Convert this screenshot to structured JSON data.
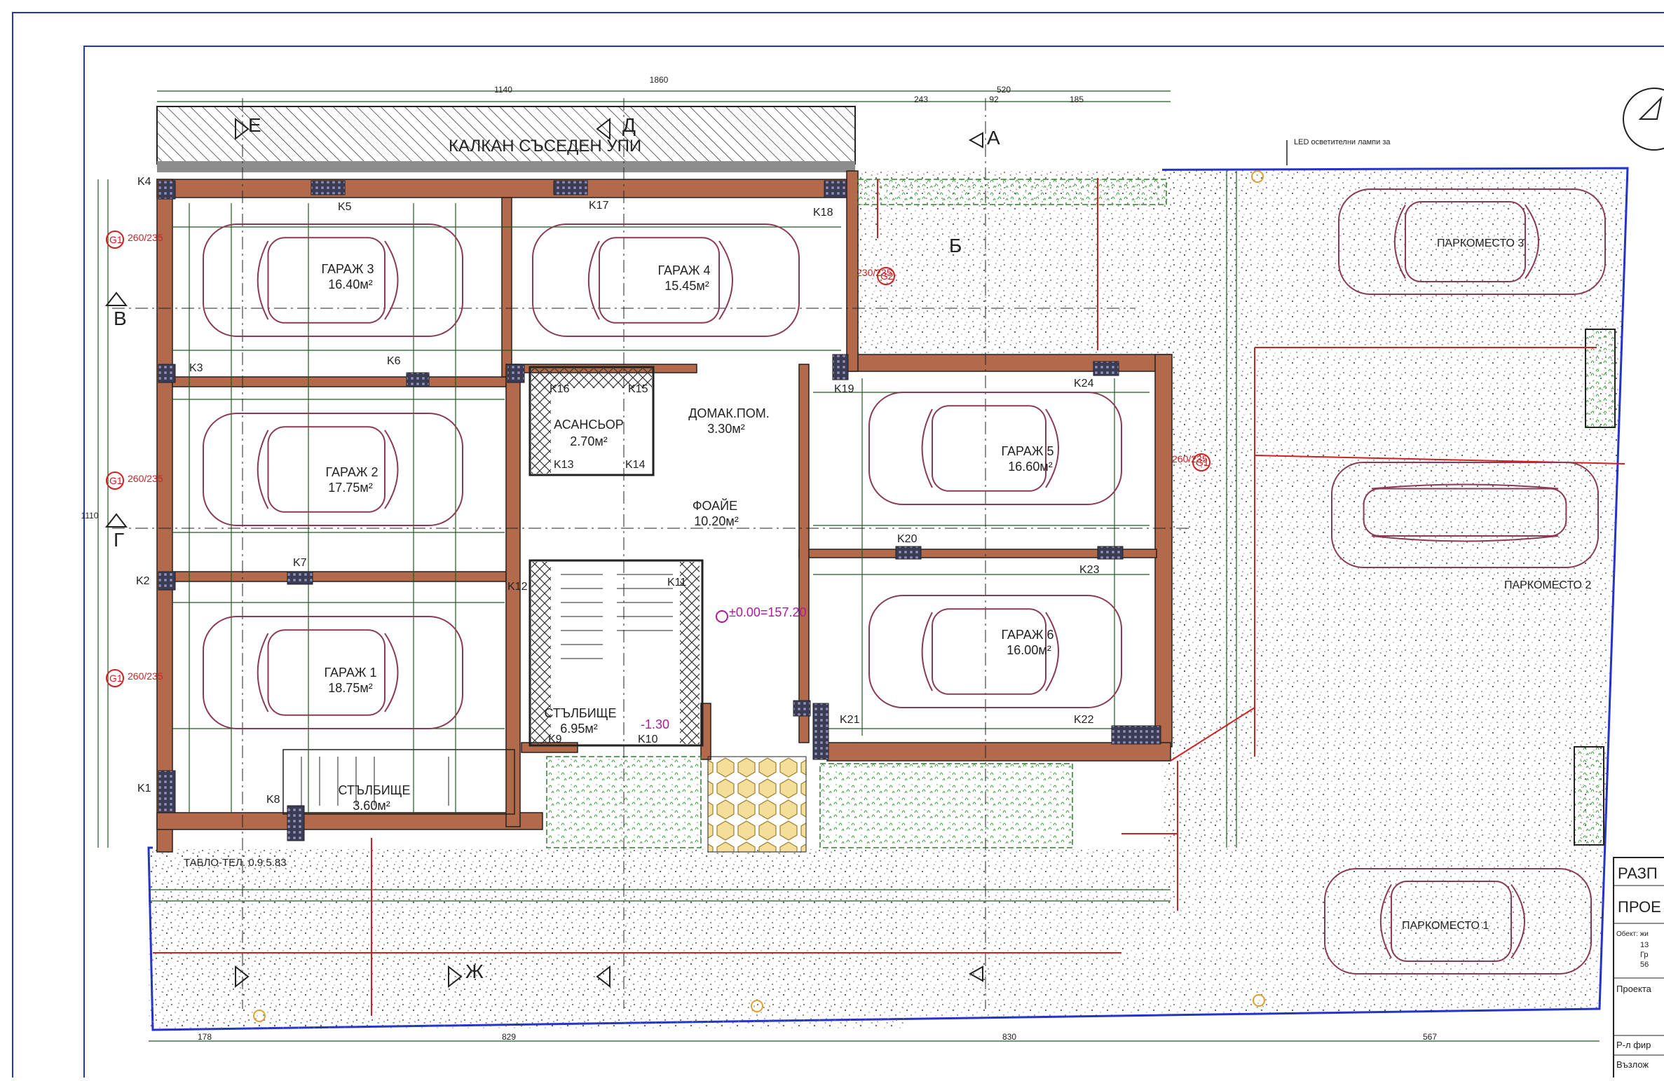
{
  "drawing": {
    "neighbor_wall_label": "КАЛКАН СЪСЕДЕН УПИ",
    "sections": [
      "В",
      "Г",
      "Д",
      "Е",
      "Ж",
      "А",
      "Б"
    ],
    "garages": [
      {
        "name": "ГАРАЖ 3",
        "area": "16.40м²"
      },
      {
        "name": "ГАРАЖ 4",
        "area": "15.45м²"
      },
      {
        "name": "ГАРАЖ 2",
        "area": "17.75м²"
      },
      {
        "name": "ГАРАЖ 1",
        "area": "18.75м²"
      },
      {
        "name": "ГАРАЖ 5",
        "area": "16.60м²"
      },
      {
        "name": "ГАРАЖ 6",
        "area": "16.00м²"
      }
    ],
    "rooms": [
      {
        "name": "АСАНСЬОР",
        "area": "2.70м²"
      },
      {
        "name": "ДОМАК.ПОМ.",
        "area": "3.30м²"
      },
      {
        "name": "ФОАЙЕ",
        "area": "10.20м²"
      },
      {
        "name": "СТЪЛБИЩЕ",
        "area": "6.95м²"
      },
      {
        "name": "СТЪЛБИЩЕ",
        "area": "3.60м²"
      }
    ],
    "parking": [
      "ПАРКОМЕСТО 3",
      "ПАРКОМЕСТО 2",
      "ПАРКОМЕСТО 1"
    ],
    "columns": [
      "K4",
      "K5",
      "K17",
      "K18",
      "K3",
      "K6",
      "K16",
      "K15",
      "K19",
      "K24",
      "K13",
      "K14",
      "K7",
      "K2",
      "K12",
      "K11",
      "K20",
      "K23",
      "K21",
      "K22",
      "K1",
      "K8",
      "K9",
      "K10"
    ],
    "level_mark": "±0.00=157.20",
    "level_minus": "-1.30",
    "led_note": "LED осветителни лампи за",
    "label_tablo": "ТАБЛО-ТЕЛ. 0.9 5.83",
    "door_marks": {
      "g1": "G1",
      "g1_dims": "260/235",
      "g2": "G2",
      "g2_dims": "230/235",
      "g3": "G1",
      "g3_dims": "260/235",
      "g4": "G1",
      "g4_dims": "260/235",
      "g5": "G1",
      "g5_dims": "260/235"
    },
    "dims_top": {
      "overall": "1860",
      "left": "1140",
      "right": "520",
      "a": "243",
      "b": "92",
      "c": "185"
    },
    "dims_bottom": {
      "a": "178",
      "b": "829",
      "c": "830",
      "d": "567"
    },
    "dims_side": {
      "left_total": "1110"
    }
  },
  "title_block": {
    "row1": "РАЗП",
    "row2": "ПРОЕ",
    "obekt_label": "Обект: жи",
    "obekt_lines": [
      "13",
      "Гр",
      "56"
    ],
    "proekt_label": "Проекта",
    "firm_label": "Р-л фир",
    "assign_label": "Възлож"
  },
  "colors": {
    "wall": "#b36a4a",
    "line": "#1a1a1a",
    "green": "#2e7d2e",
    "dim": "#1d5a1d",
    "car": "#8b3a55",
    "red": "#d21f1f",
    "magenta": "#b0179f",
    "blue": "#2433c9",
    "yellow": "#e0b45a"
  }
}
